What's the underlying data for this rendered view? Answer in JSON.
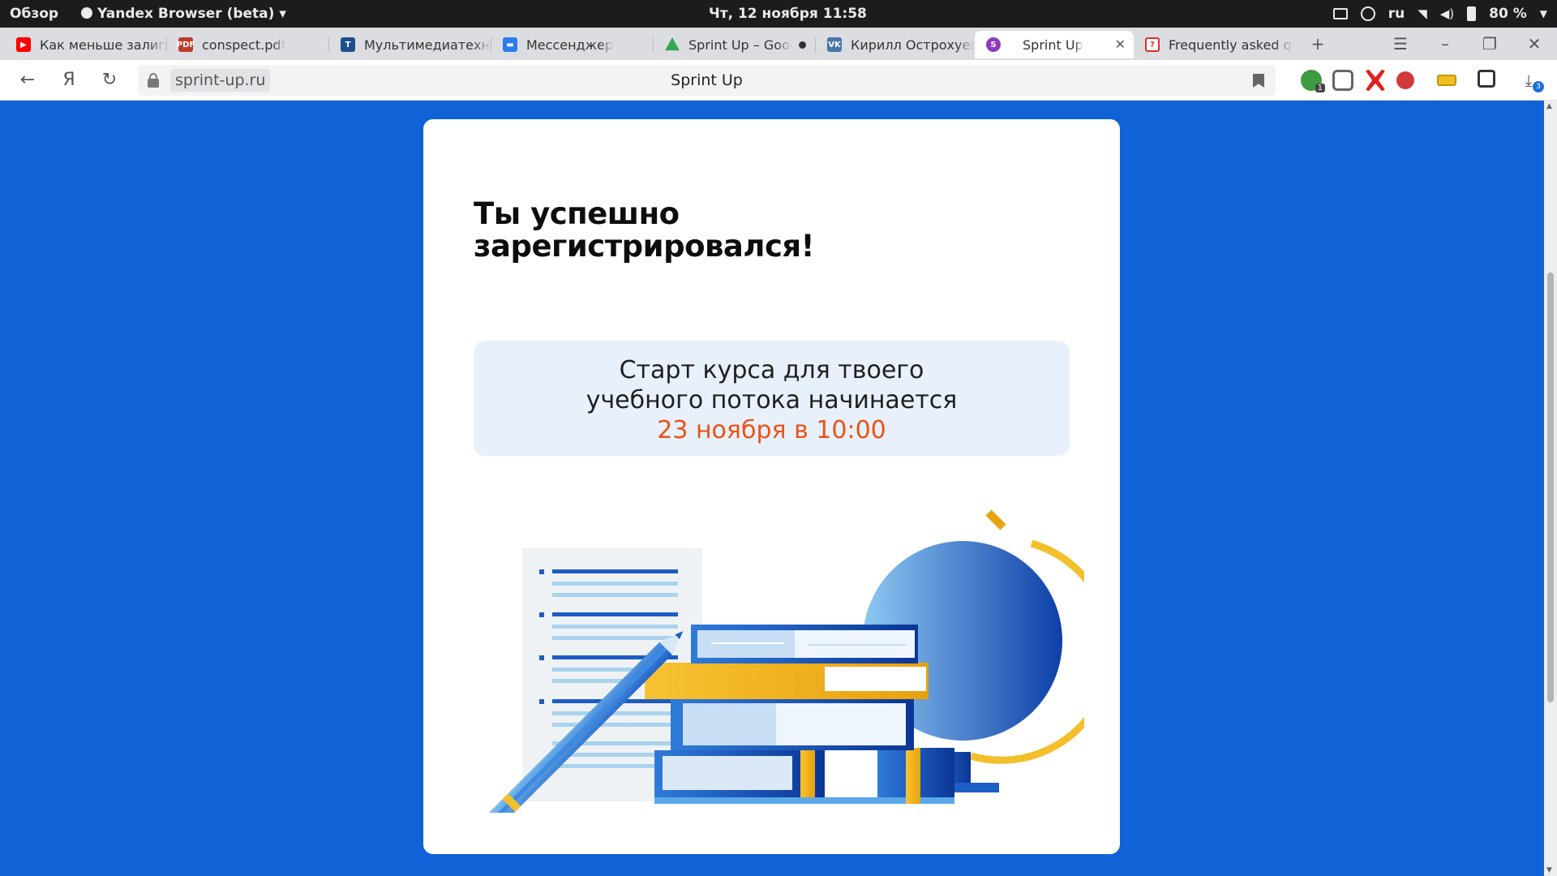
{
  "topbar": {
    "overview": "Обзор",
    "app_name": "Yandex Browser (beta)",
    "clock": "Чт, 12 ноября  11:58",
    "language": "ru",
    "battery": "80 %"
  },
  "tabs": [
    {
      "title": "Как меньше залипать",
      "favicon": "youtube-icon",
      "color": "#ff0000"
    },
    {
      "title": "conspect.pdf",
      "favicon": "pdf-icon",
      "color": "#c0392b"
    },
    {
      "title": "Мультимедиатехнологии",
      "favicon": "document-icon",
      "color": "#1e4f8c"
    },
    {
      "title": "Мессенджер",
      "favicon": "messenger-icon",
      "color": "#2b7de9"
    },
    {
      "title": "Sprint Up – Google",
      "favicon": "google-drive-icon",
      "color": "#34a853"
    },
    {
      "title": "Кирилл Острохуевский",
      "favicon": "vk-icon",
      "color": "#4a76a8"
    },
    {
      "title": "Sprint Up",
      "favicon": "sprint-up-icon",
      "color": "#8e3bbd"
    },
    {
      "title": "Frequently asked questions",
      "favicon": "faq-icon",
      "color": "#d93025"
    }
  ],
  "navbar": {
    "domain": "sprint-up.ru",
    "page_title": "Sprint Up",
    "yandex_glyph": "Я",
    "download_count": "3",
    "extension_badge": "1"
  },
  "card": {
    "heading_line1": "Ты успешно",
    "heading_line2": "зарегистрировался!",
    "info_line1": "Старт курса для твоего",
    "info_line2": "учебного потока начинается",
    "info_date": "23 ноября в 10:00",
    "date_color": "#ea5318"
  },
  "colors": {
    "page_bg": "#1162d6",
    "card_bg": "#ffffff",
    "info_bg": "#e8f0fb"
  }
}
